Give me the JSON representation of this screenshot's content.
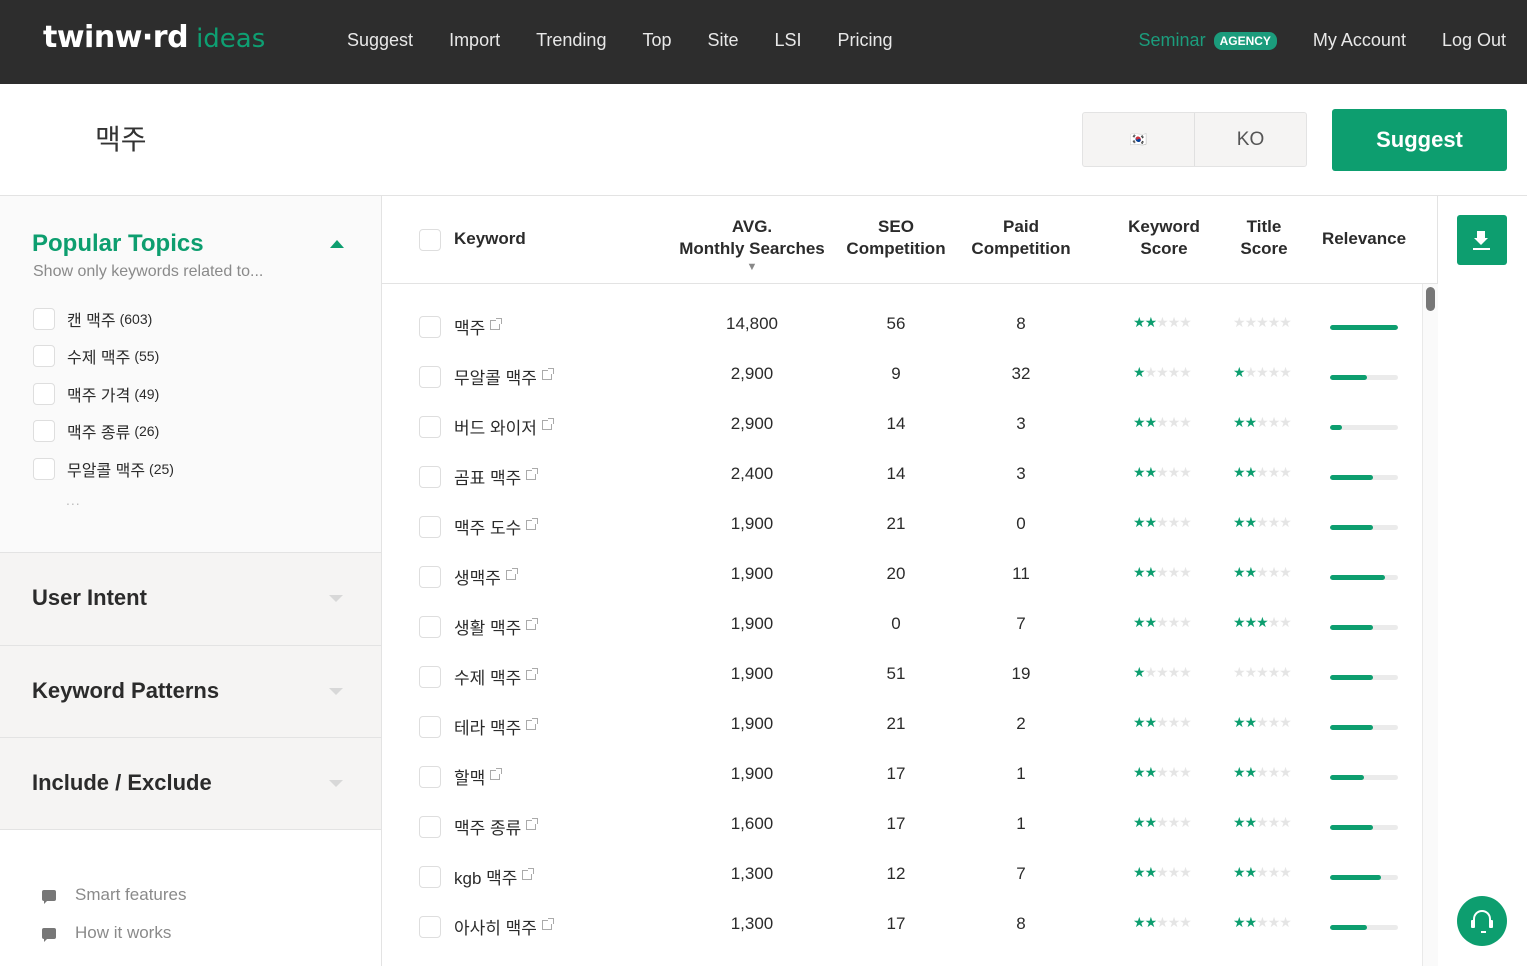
{
  "header": {
    "logo_main": "twinw·rd",
    "logo_sub": "ideas",
    "nav": [
      "Suggest",
      "Import",
      "Trending",
      "Top",
      "Site",
      "LSI",
      "Pricing"
    ],
    "workspace": "Seminar",
    "plan_badge": "AGENCY",
    "account": "My Account",
    "logout": "Log Out"
  },
  "search": {
    "query": "맥주",
    "country_flag": "🇰🇷",
    "language": "KO",
    "submit_label": "Suggest"
  },
  "sidebar": {
    "popular_topics": {
      "title": "Popular Topics",
      "subtitle": "Show only keywords related to...",
      "items": [
        {
          "label": "캔 맥주",
          "count": "(603)"
        },
        {
          "label": "수제 맥주",
          "count": "(55)"
        },
        {
          "label": "맥주 가격",
          "count": "(49)"
        },
        {
          "label": "맥주 종류",
          "count": "(26)"
        },
        {
          "label": "무알콜 맥주",
          "count": "(25)"
        }
      ],
      "more": "..."
    },
    "sections": [
      "User Intent",
      "Keyword Patterns",
      "Include / Exclude"
    ],
    "links": [
      "Smart features",
      "How it works"
    ]
  },
  "table": {
    "columns": {
      "keyword": "Keyword",
      "avg_line1": "AVG.",
      "avg_line2": "Monthly Searches",
      "seo_line1": "SEO",
      "seo_line2": "Competition",
      "paid_line1": "Paid",
      "paid_line2": "Competition",
      "ks_line1": "Keyword",
      "ks_line2": "Score",
      "ts_line1": "Title",
      "ts_line2": "Score",
      "relevance": "Relevance",
      "sort_indicator": "▼"
    },
    "rows": [
      {
        "keyword": "맥주",
        "searches": "14,800",
        "seo": "56",
        "paid": "8",
        "keyword_score": 2,
        "title_score": 0,
        "relevance": 1.0
      },
      {
        "keyword": "무알콜 맥주",
        "searches": "2,900",
        "seo": "9",
        "paid": "32",
        "keyword_score": 1,
        "title_score": 1,
        "relevance": 0.55
      },
      {
        "keyword": "버드 와이저",
        "searches": "2,900",
        "seo": "14",
        "paid": "3",
        "keyword_score": 2,
        "title_score": 2,
        "relevance": 0.17
      },
      {
        "keyword": "곰표 맥주",
        "searches": "2,400",
        "seo": "14",
        "paid": "3",
        "keyword_score": 2,
        "title_score": 2,
        "relevance": 0.63
      },
      {
        "keyword": "맥주 도수",
        "searches": "1,900",
        "seo": "21",
        "paid": "0",
        "keyword_score": 2,
        "title_score": 2,
        "relevance": 0.63
      },
      {
        "keyword": "생맥주",
        "searches": "1,900",
        "seo": "20",
        "paid": "11",
        "keyword_score": 2,
        "title_score": 2,
        "relevance": 0.81
      },
      {
        "keyword": "생활 맥주",
        "searches": "1,900",
        "seo": "0",
        "paid": "7",
        "keyword_score": 2,
        "title_score": 3,
        "relevance": 0.63
      },
      {
        "keyword": "수제 맥주",
        "searches": "1,900",
        "seo": "51",
        "paid": "19",
        "keyword_score": 1,
        "title_score": 0,
        "relevance": 0.63
      },
      {
        "keyword": "테라 맥주",
        "searches": "1,900",
        "seo": "21",
        "paid": "2",
        "keyword_score": 2,
        "title_score": 2,
        "relevance": 0.63
      },
      {
        "keyword": "할맥",
        "searches": "1,900",
        "seo": "17",
        "paid": "1",
        "keyword_score": 2,
        "title_score": 2,
        "relevance": 0.5
      },
      {
        "keyword": "맥주 종류",
        "searches": "1,600",
        "seo": "17",
        "paid": "1",
        "keyword_score": 2,
        "title_score": 2,
        "relevance": 0.63
      },
      {
        "keyword": "kgb 맥주",
        "searches": "1,300",
        "seo": "12",
        "paid": "7",
        "keyword_score": 2,
        "title_score": 2,
        "relevance": 0.75
      },
      {
        "keyword": "아사히 맥주",
        "searches": "1,300",
        "seo": "17",
        "paid": "8",
        "keyword_score": 2,
        "title_score": 2,
        "relevance": 0.55
      }
    ],
    "max_stars": 5
  },
  "colors": {
    "accent": "#0d9e6f",
    "topbar": "#2d2d2d",
    "badge": "#1b9c7c"
  }
}
